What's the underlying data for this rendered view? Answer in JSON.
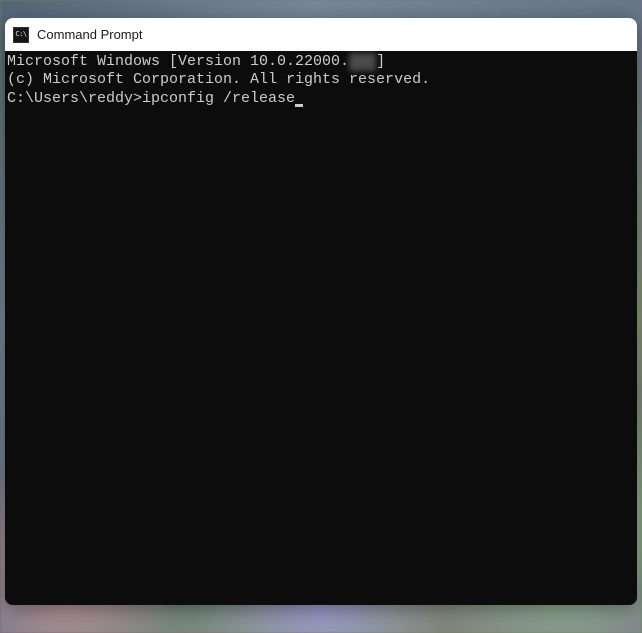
{
  "window": {
    "title": "Command Prompt",
    "icon_name": "cmd-icon",
    "icon_text": "C:\\"
  },
  "terminal": {
    "line1_prefix": "Microsoft Windows [Version 10.0.22000.",
    "line1_suffix": "]",
    "line1_obscured": "xxx",
    "line2": "(c) Microsoft Corporation. All rights reserved.",
    "blank": "",
    "prompt": "C:\\Users\\reddy>",
    "command": "ipconfig /release"
  }
}
